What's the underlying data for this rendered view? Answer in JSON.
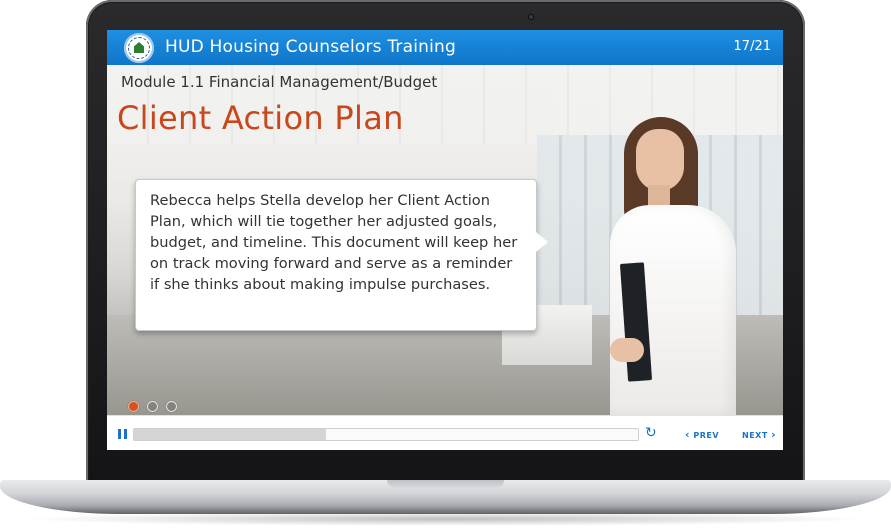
{
  "app": {
    "title": "HUD Housing Counselors Training",
    "page_counter": "17/21"
  },
  "slide": {
    "module_label": "Module 1.1  Financial Management/Budget",
    "title": "Client Action Plan",
    "bubble_text": "Rebecca helps Stella develop her Client Action Plan, which will tie together her adjusted goals, budget, and timeline. This document will keep her on track moving forward and serve as a reminder if she thinks about making impulse purchases.",
    "carousel": {
      "count": 3,
      "active_index": 0
    }
  },
  "controls": {
    "pause_icon": "pause-icon",
    "progress_fraction": 0.38,
    "replay_icon": "replay-icon",
    "prev_label": "PREV",
    "next_label": "NEXT"
  },
  "colors": {
    "titlebar": "#1a84d6",
    "title_orange": "#c9471c",
    "accent_blue": "#1a73c9",
    "dot_active": "#d4531f"
  }
}
